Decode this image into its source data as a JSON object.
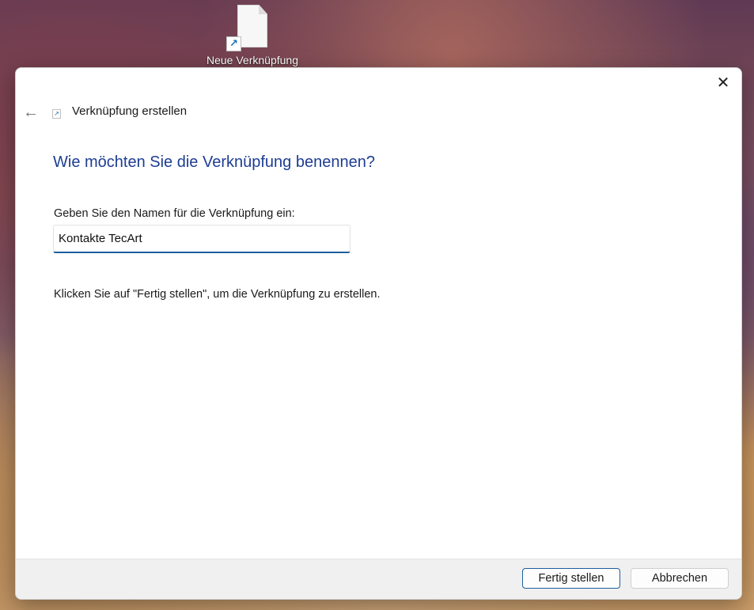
{
  "desktop": {
    "icon_label": "Neue Verknüpfung",
    "icon": "file-shortcut-icon"
  },
  "dialog": {
    "window_title": "Verknüpfung erstellen",
    "close_icon": "close-icon",
    "back_icon": "back-arrow-icon",
    "heading": "Wie möchten Sie die Verknüpfung benennen?",
    "name_field": {
      "label": "Geben Sie den Namen für die Verknüpfung ein:",
      "value": "Kontakte TecArt"
    },
    "hint": "Klicken Sie auf \"Fertig stellen\", um die Verknüpfung zu erstellen.",
    "buttons": {
      "finish": "Fertig stellen",
      "cancel": "Abbrechen"
    }
  },
  "colors": {
    "heading": "#1e3d93",
    "accent": "#1d5f9e"
  }
}
